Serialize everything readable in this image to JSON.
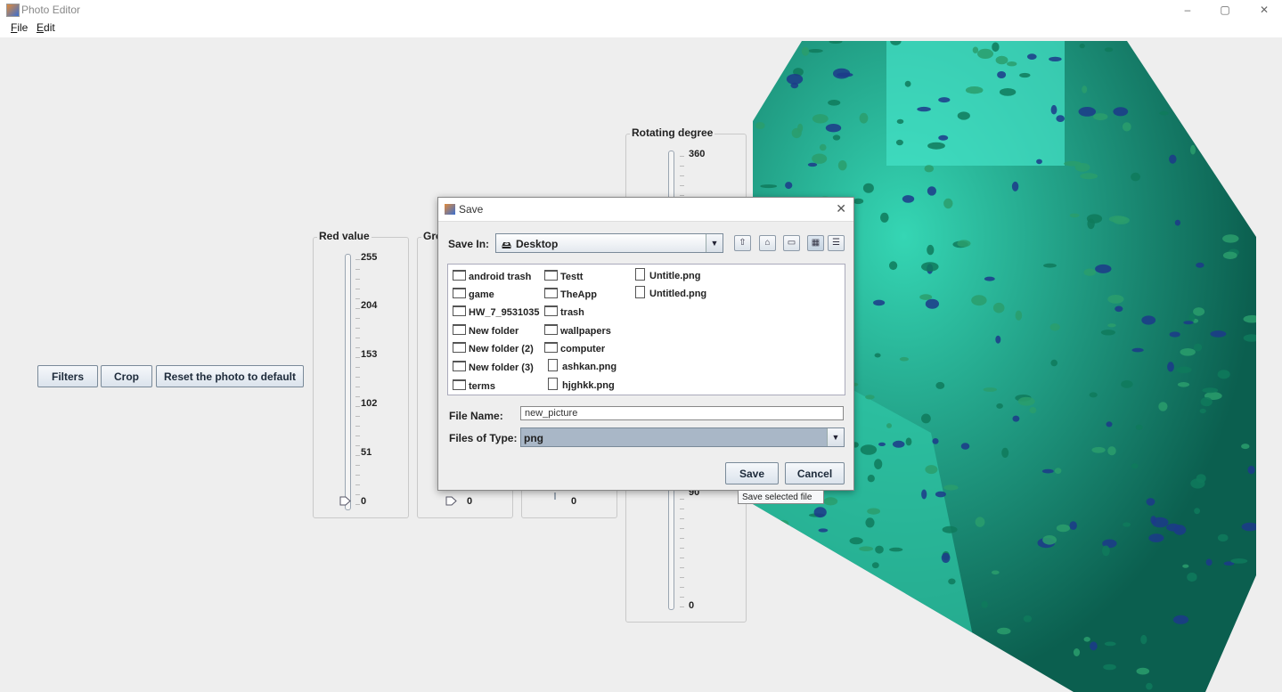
{
  "window": {
    "title": "Photo Editor",
    "controls": [
      "–",
      "▢",
      "✕"
    ]
  },
  "menu": {
    "file": {
      "mnemonic": "F",
      "rest": "ile"
    },
    "edit": {
      "mnemonic": "E",
      "rest": "dit"
    }
  },
  "toolbar": {
    "filters_label": "Filters",
    "crop_label": "Crop",
    "reset_label": "Reset the photo to default"
  },
  "sliders": {
    "red": {
      "title": "Red value",
      "ticks": [
        "255",
        "204",
        "153",
        "102",
        "51",
        "0"
      ],
      "value": 0
    },
    "green": {
      "title": "Gre",
      "ticks": [
        "0"
      ],
      "value": 0
    },
    "blue": {
      "ticks": [
        "0"
      ],
      "value": 0
    },
    "rotate": {
      "title": "Rotating degree",
      "ticks": [
        "360",
        "90",
        "0"
      ]
    }
  },
  "dialog": {
    "title": "Save",
    "save_in_label": "Save In:",
    "save_in_value": "Desktop",
    "file_name_label": "File Name:",
    "file_name_value": "new_picture",
    "files_type_label": "Files of Type:",
    "files_type_value": "png",
    "save_button": "Save",
    "cancel_button": "Cancel",
    "tooltip": "Save selected file",
    "files": [
      {
        "name": "android trash",
        "kind": "folder"
      },
      {
        "name": "game",
        "kind": "folder"
      },
      {
        "name": "HW_7_9531035",
        "kind": "folder"
      },
      {
        "name": "New folder",
        "kind": "folder"
      },
      {
        "name": "New folder (2)",
        "kind": "folder"
      },
      {
        "name": "New folder (3)",
        "kind": "folder"
      },
      {
        "name": "terms",
        "kind": "folder"
      },
      {
        "name": "Testt",
        "kind": "folder"
      },
      {
        "name": "TheApp",
        "kind": "folder"
      },
      {
        "name": "trash",
        "kind": "folder"
      },
      {
        "name": "wallpapers",
        "kind": "folder"
      },
      {
        "name": "computer",
        "kind": "folder"
      },
      {
        "name": "ashkan.png",
        "kind": "file"
      },
      {
        "name": "hjghkk.png",
        "kind": "file"
      },
      {
        "name": "Untitle.png",
        "kind": "file"
      },
      {
        "name": "Untitled.png",
        "kind": "file"
      }
    ]
  },
  "colors": {
    "photo_tint": "#1fb89a",
    "type_combo_bg": "#a9b7c7"
  }
}
